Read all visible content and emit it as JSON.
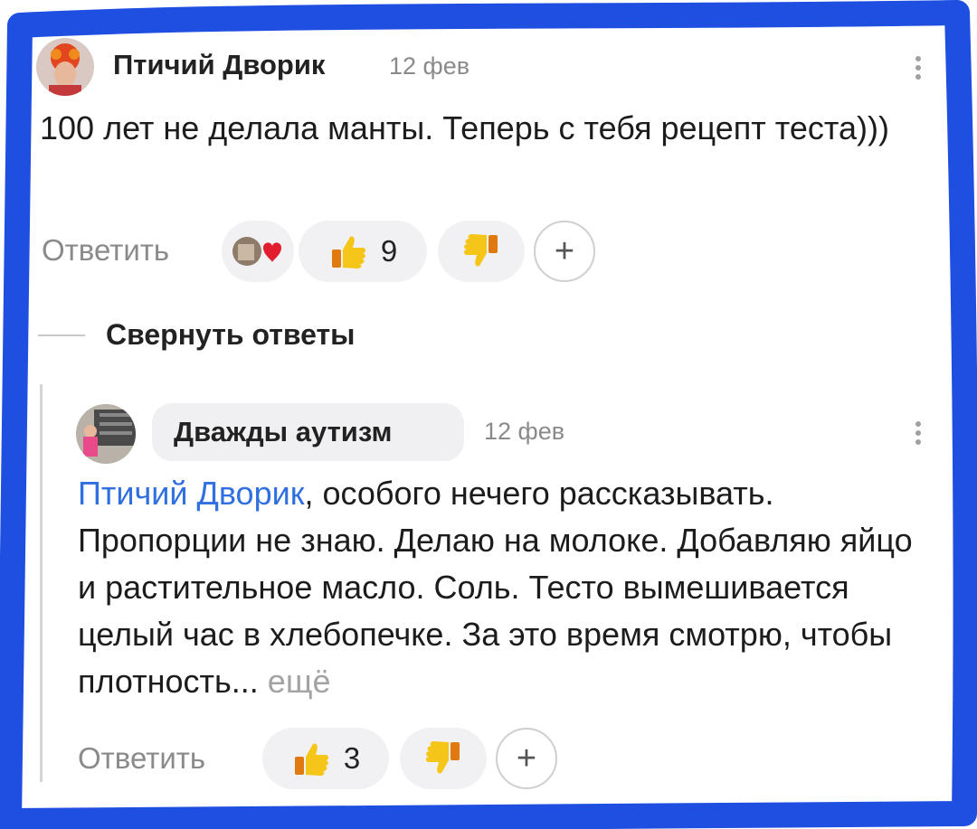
{
  "comment": {
    "author": "Птичий Дворик",
    "date": "12 фев",
    "text": "100 лет не делала манты. Теперь с тебя рецепт теста)))",
    "reply_label": "Ответить",
    "likes": "9",
    "plus_label": "+"
  },
  "collapse_label": "Свернуть ответы",
  "reply": {
    "author": "Дважды аутизм",
    "date": "12 фев",
    "mention": "Птичий Дворик",
    "text": ", особого нечего рассказывать. Пропорции не знаю. Делаю на молоке. Добавляю яйцо и растительное масло. Соль. Тесто вымешивается целый час в хлебопечке. За это время смотрю, чтобы плотность...",
    "more_label": "ещё",
    "reply_label": "Ответить",
    "likes": "3",
    "plus_label": "+"
  },
  "colors": {
    "frame": "#1f4fe0",
    "mention": "#2f6fe0",
    "like": "#f5c518"
  },
  "icons": [
    "kebab-menu-icon",
    "thumbs-up-icon",
    "thumbs-down-icon",
    "heart-icon",
    "plus-icon"
  ]
}
